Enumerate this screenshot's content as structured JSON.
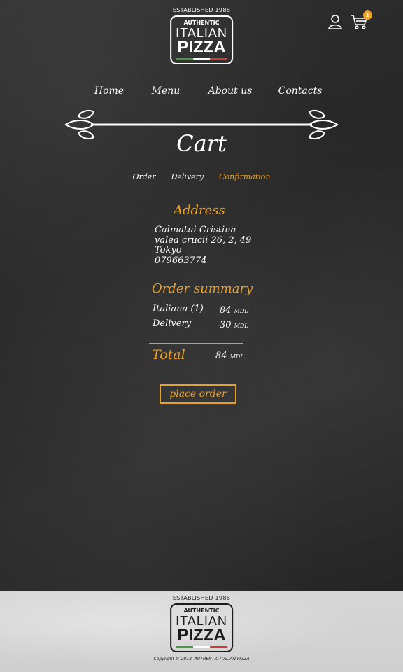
{
  "header": {
    "logo": {
      "established": "ESTABLISHED 1988",
      "line1": "AUTHENTIC",
      "line2": "ITALIAN",
      "line3": "PIZZA",
      "flag_colors": [
        "#3aa23a",
        "#ffffff",
        "#d93535"
      ]
    },
    "cart_count": "1",
    "icons": [
      "user-icon",
      "cart-icon"
    ]
  },
  "nav": {
    "items": [
      {
        "label": "Home"
      },
      {
        "label": "Menu"
      },
      {
        "label": "About us"
      },
      {
        "label": "Contacts"
      }
    ]
  },
  "page": {
    "title": "Cart",
    "steps": [
      {
        "label": "Order",
        "active": false
      },
      {
        "label": "Delivery",
        "active": false
      },
      {
        "label": "Confirmation",
        "active": true
      }
    ],
    "address": {
      "title": "Address",
      "lines": [
        "Calmatui Cristina",
        "valea crucii 26, 2, 49",
        "Tokyo",
        "079663774"
      ]
    },
    "summary": {
      "title": "Order summary",
      "rows": [
        {
          "label": "Italiana (1)",
          "value": "84",
          "unit": "MDL"
        },
        {
          "label": "Delivery",
          "value": "30",
          "unit": "MDL"
        }
      ],
      "total_label": "Total",
      "total_value": "84",
      "total_unit": "MDL"
    },
    "place_order_label": "place order"
  },
  "footer": {
    "logo": {
      "established": "ESTABLISHED 1988",
      "line1": "AUTHENTIC",
      "line2": "ITALIAN",
      "line3": "PIZZA"
    },
    "copyright": "Copyright © 2018, AUTHENTIC ITALIAN PIZZA"
  },
  "colors": {
    "accent": "#f0a020",
    "board": "#2a2a2a",
    "footer": "#d4d4d4"
  }
}
